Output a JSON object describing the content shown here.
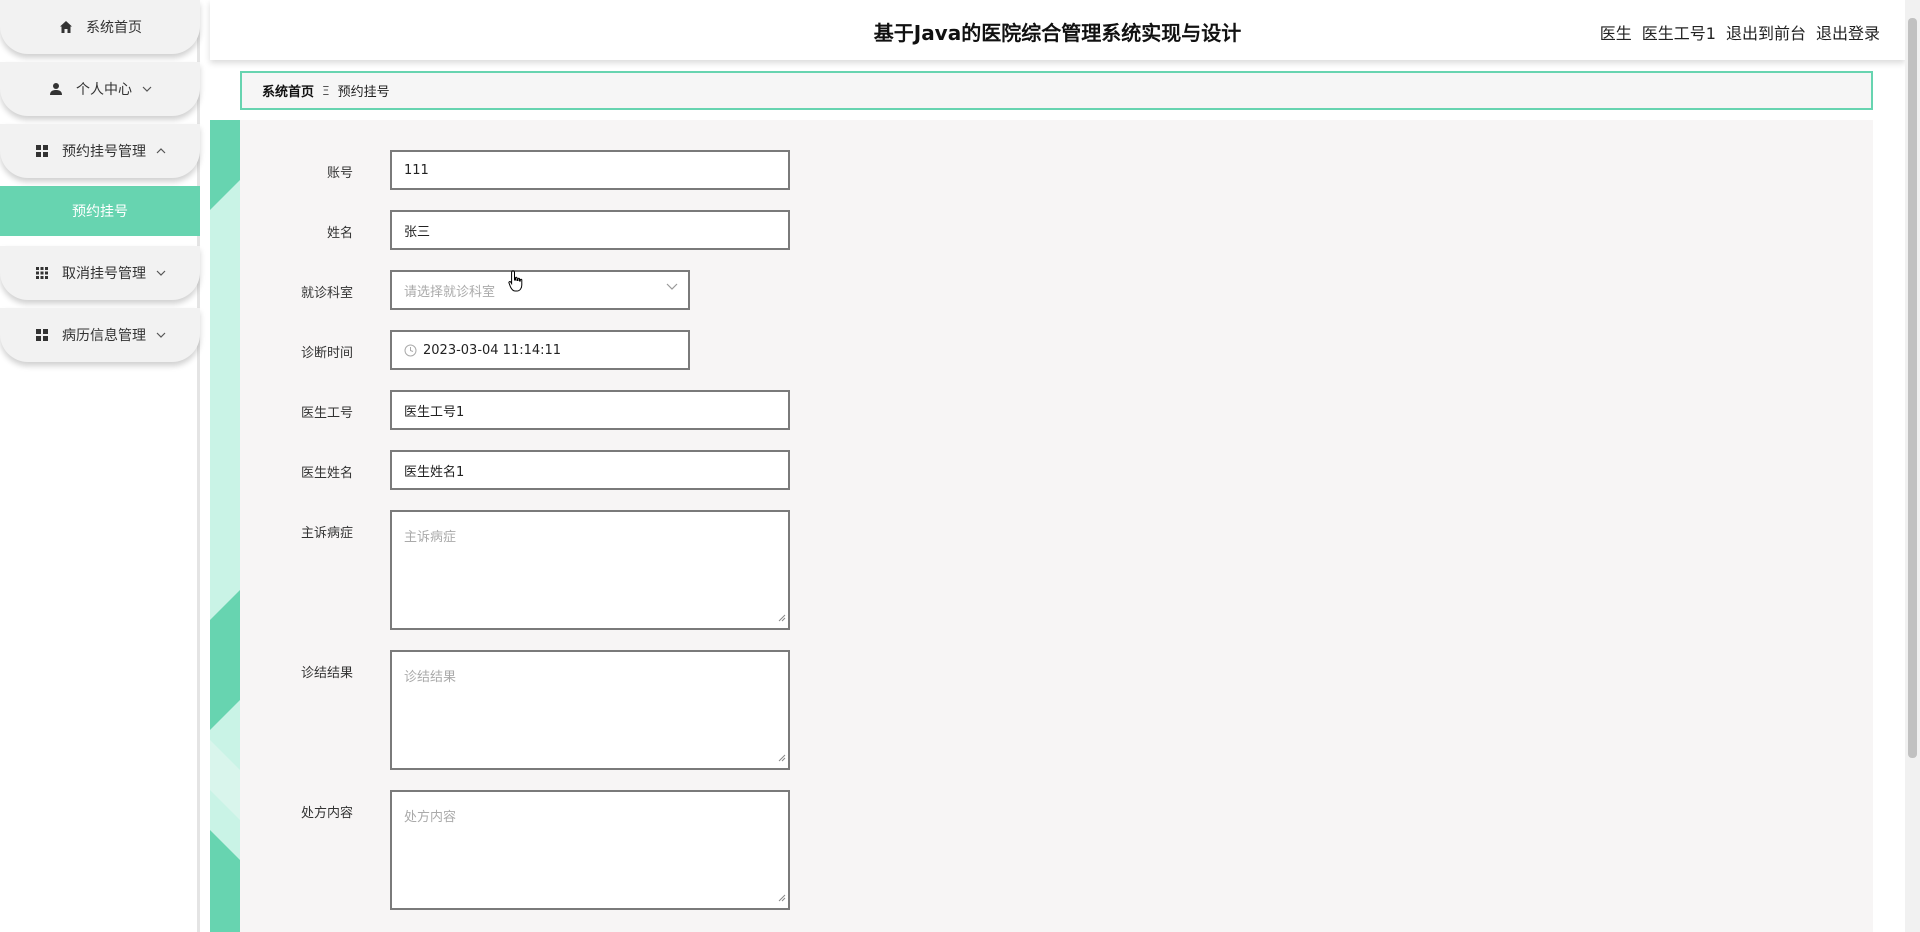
{
  "header": {
    "title": "基于Java的医院综合管理系统实现与设计",
    "user_role": "医生",
    "user_name": "医生工号1",
    "to_front_label": "退出到前台",
    "logout_label": "退出登录"
  },
  "sidebar": {
    "items": [
      {
        "label": "系统首页",
        "icon": "home-icon"
      },
      {
        "label": "个人中心",
        "icon": "user-icon"
      },
      {
        "label": "预约挂号管理",
        "icon": "grid-icon"
      },
      {
        "label": "取消挂号管理",
        "icon": "grid9-icon"
      },
      {
        "label": "病历信息管理",
        "icon": "grid-icon"
      }
    ],
    "submenu": {
      "label": "预约挂号"
    }
  },
  "breadcrumb": {
    "home": "系统首页",
    "separator": "Ξ",
    "current": "预约挂号"
  },
  "form": {
    "account": {
      "label": "账号",
      "value": "111"
    },
    "name": {
      "label": "姓名",
      "value": "张三"
    },
    "department": {
      "label": "就诊科室",
      "placeholder": "请选择就诊科室"
    },
    "diagnosis_time": {
      "label": "诊断时间",
      "value": "2023-03-04 11:14:11"
    },
    "doctor_id": {
      "label": "医生工号",
      "value": "医生工号1"
    },
    "doctor_name": {
      "label": "医生姓名",
      "value": "医生姓名1"
    },
    "complaint": {
      "label": "主诉病症",
      "placeholder": "主诉病症"
    },
    "result": {
      "label": "诊结结果",
      "placeholder": "诊结结果"
    },
    "prescription": {
      "label": "处方内容",
      "placeholder": "处方内容"
    }
  },
  "colors": {
    "accent": "#67d4b0",
    "border": "#7a7a7a",
    "form_bg": "#f7f5f5"
  }
}
